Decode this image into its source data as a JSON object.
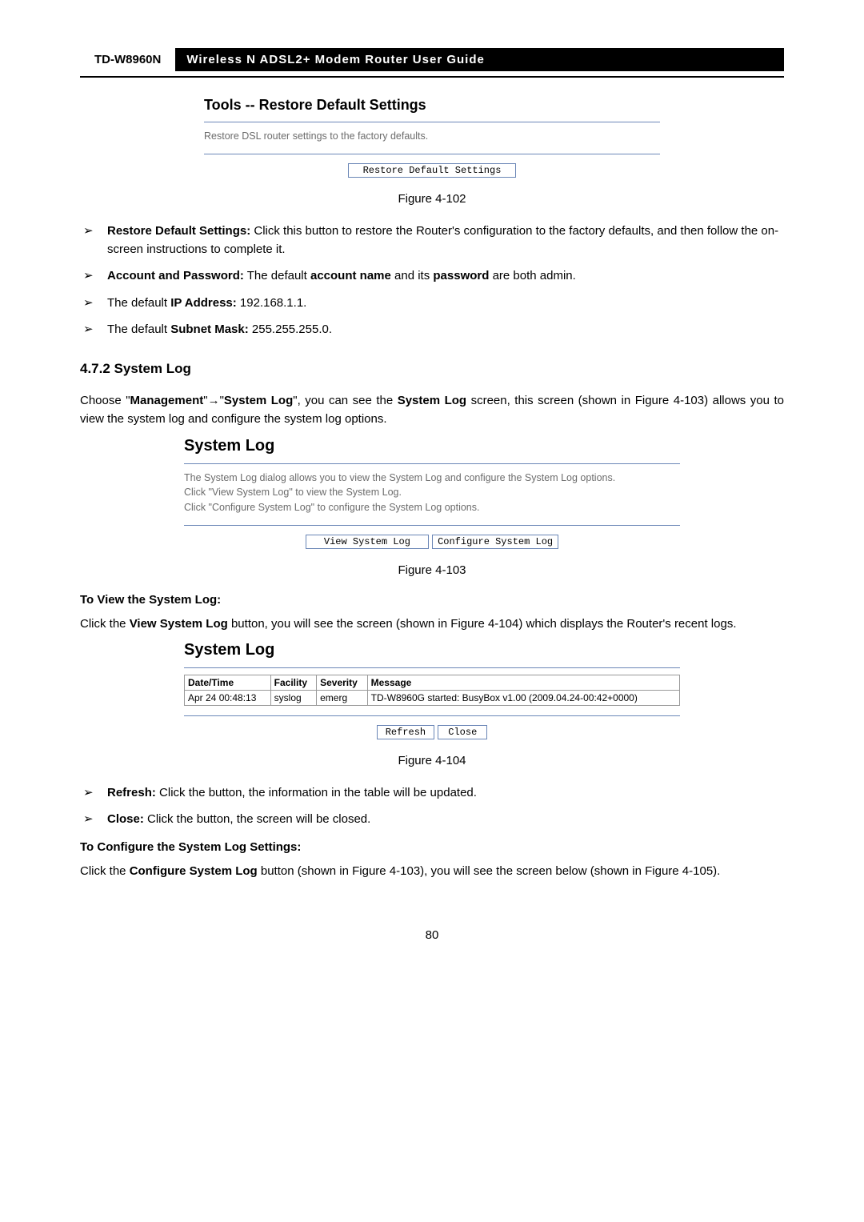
{
  "header": {
    "model": "TD-W8960N",
    "title": "Wireless  N  ADSL2+  Modem  Router  User  Guide"
  },
  "restore_box": {
    "heading": "Tools -- Restore Default Settings",
    "desc": "Restore DSL router settings to the factory defaults.",
    "button": "Restore Default Settings"
  },
  "fig1_caption": "Figure 4-102",
  "bullets1": {
    "b1_label": "Restore Default Settings:",
    "b1_text": " Click this button to restore the Router's configuration to the factory defaults, and then follow the on-screen instructions to complete it.",
    "b2_label": "Account and Password:",
    "b2_text_a": " The default ",
    "b2_bold_a": "account name",
    "b2_text_b": " and its ",
    "b2_bold_b": "password",
    "b2_text_c": " are both admin.",
    "b3_text_a": "The default ",
    "b3_bold": "IP Address:",
    "b3_text_b": " 192.168.1.1.",
    "b4_text_a": "The default ",
    "b4_bold": "Subnet Mask:",
    "b4_text_b": " 255.255.255.0."
  },
  "section_heading": "4.7.2   System Log",
  "para1": {
    "t1": "Choose \"",
    "b1": "Management",
    "t2": "\"",
    "arrow": "→",
    "t3": "\"",
    "b2": "System Log",
    "t4": "\",  you  can  see  the  ",
    "b3": "System  Log",
    "t5": "  screen,  this  screen (shown in Figure 4-103) allows you to view the system log and configure the system log options."
  },
  "syslog_box": {
    "heading": "System Log",
    "line1": "The System Log dialog allows you to view the System Log and configure the System Log options.",
    "line2": "Click \"View System Log\" to view the System Log.",
    "line3": "Click \"Configure System Log\" to configure the System Log options.",
    "btn1": "View System Log",
    "btn2": "Configure System Log"
  },
  "fig2_caption": "Figure 4-103",
  "sub1": "To View the System Log:",
  "para2": {
    "t1": "Click the ",
    "b1": "View System Log",
    "t2": " button, you will see the screen (shown in Figure 4-104) which displays the Router's recent logs."
  },
  "syslog_view": {
    "heading": "System Log",
    "headers": {
      "c1": "Date/Time",
      "c2": "Facility",
      "c3": "Severity",
      "c4": "Message"
    },
    "row": {
      "c1": "Apr 24 00:48:13",
      "c2": "syslog",
      "c3": "emerg",
      "c4": "TD-W8960G started: BusyBox v1.00 (2009.04.24-00:42+0000)"
    },
    "btn1": "Refresh",
    "btn2": "Close"
  },
  "fig3_caption": "Figure 4-104",
  "bullets2": {
    "b1_label": "Refresh:",
    "b1_text": " Click the button, the information in the table will be updated.",
    "b2_label": "Close:",
    "b2_text": " Click the button, the screen will be closed."
  },
  "sub2": "To Configure the System Log Settings:",
  "para3": {
    "t1": "Click the ",
    "b1": "Configure System Log",
    "t2": " button (shown in Figure 4-103), you will see the screen below (shown in Figure 4-105)."
  },
  "page_number": "80"
}
